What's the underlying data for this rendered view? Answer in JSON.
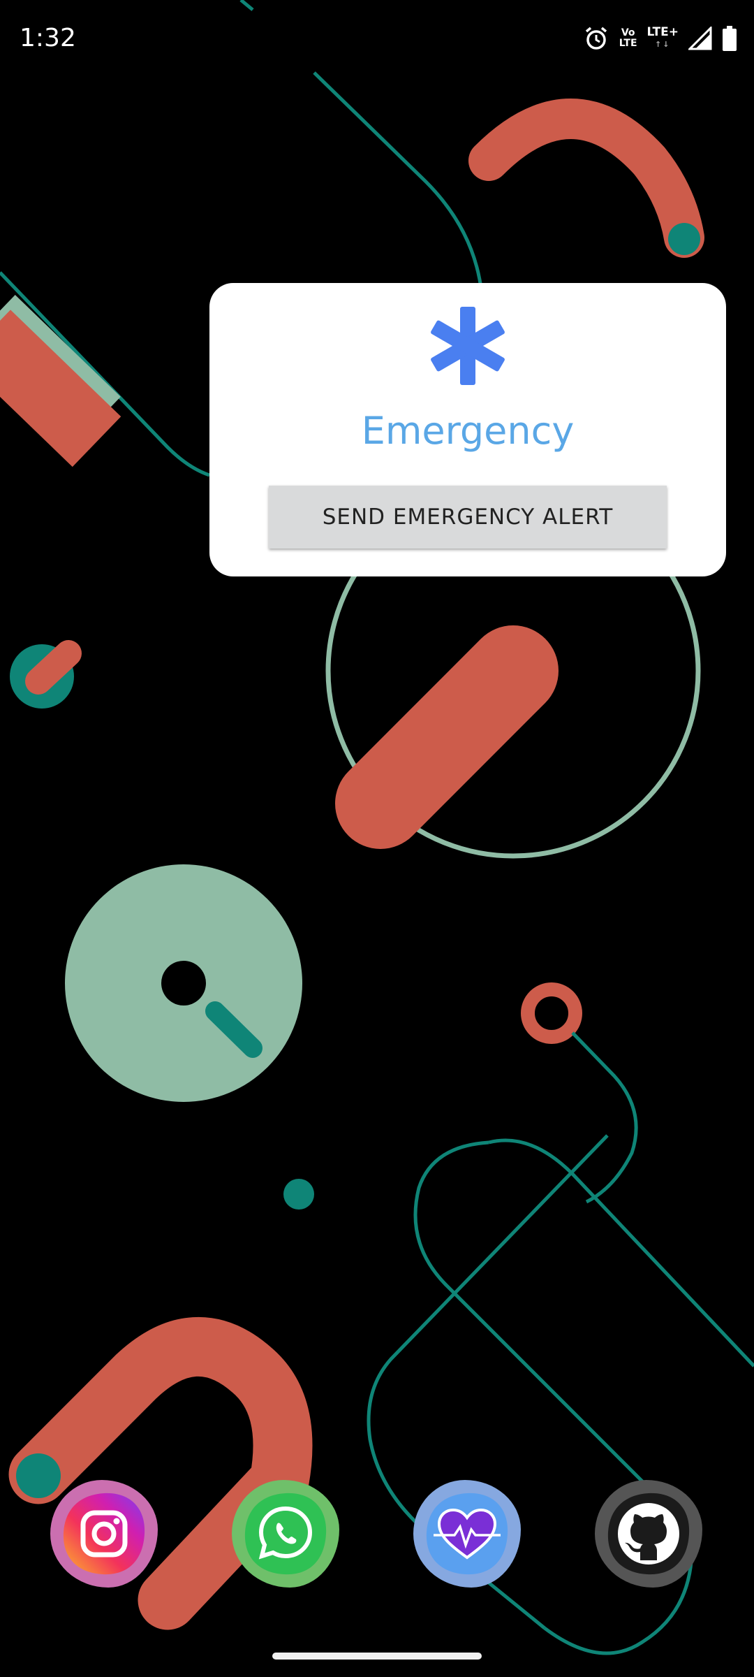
{
  "status_bar": {
    "time": "1:32",
    "volte_top": "Vo",
    "volte_bottom": "LTE",
    "network": "LTE+",
    "icons": [
      "alarm-icon",
      "volte-icon",
      "lte-plus-icon",
      "signal-icon",
      "battery-icon"
    ]
  },
  "widget": {
    "icon": "medical-asterisk-icon",
    "title": "Emergency",
    "button_label": "SEND EMERGENCY ALERT",
    "accent_color": "#4a7ff0",
    "title_color": "#5aa7e6"
  },
  "dock": {
    "apps": [
      {
        "name": "Instagram",
        "icon": "instagram-icon"
      },
      {
        "name": "WhatsApp",
        "icon": "whatsapp-icon"
      },
      {
        "name": "Health",
        "icon": "heart-pulse-icon"
      },
      {
        "name": "GitHub",
        "icon": "github-icon"
      }
    ]
  },
  "colors": {
    "background": "#000000",
    "coral": "#cd5c4b",
    "sage": "#8fbca5",
    "teal": "#0f8577"
  }
}
